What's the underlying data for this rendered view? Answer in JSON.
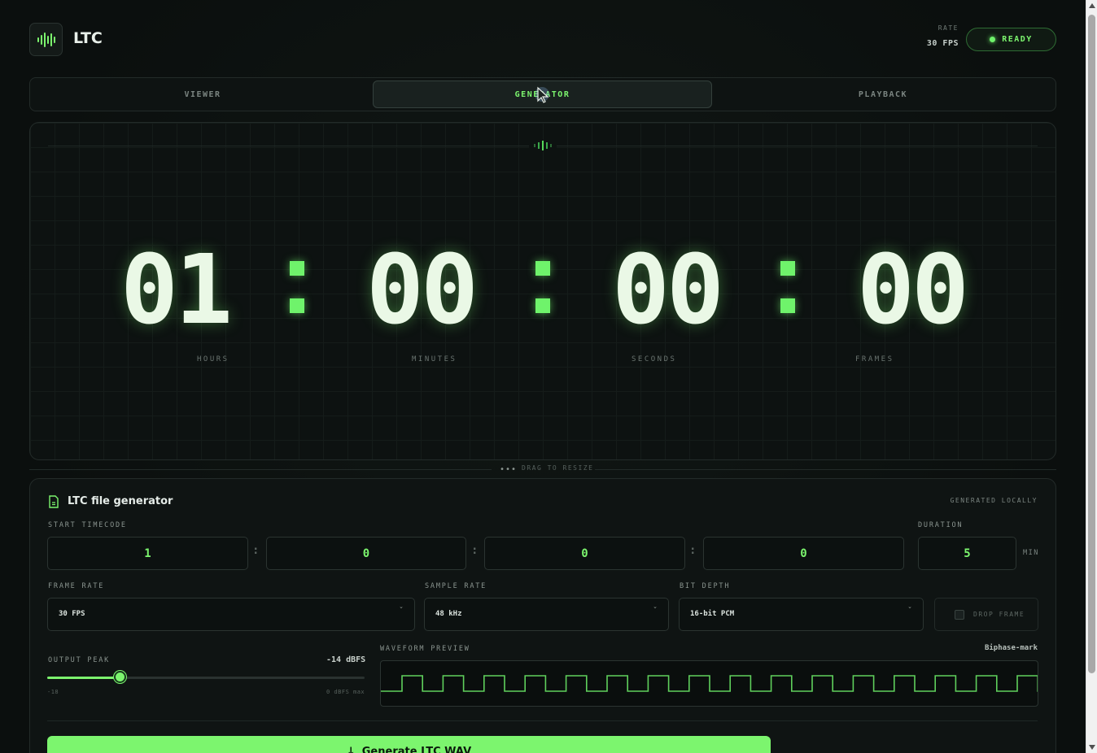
{
  "app": {
    "brand": "LTC"
  },
  "status": {
    "rate_label": "RATE",
    "rate_value": "30 FPS",
    "state": "READY"
  },
  "tabs": [
    {
      "label": "VIEWER",
      "active": false
    },
    {
      "label": "GENERATOR",
      "active": true
    },
    {
      "label": "PLAYBACK",
      "active": false
    }
  ],
  "timecode": {
    "hours": "01",
    "minutes": "00",
    "seconds": "00",
    "frames": "00",
    "labels": {
      "hours": "HOURS",
      "minutes": "MINUTES",
      "seconds": "SECONDS",
      "frames": "FRAMES"
    }
  },
  "resize": {
    "label": "DRAG TO RESIZE",
    "dots": "•••"
  },
  "generator": {
    "title": "LTC file generator",
    "note": "GENERATED LOCALLY",
    "start_label": "START TIMECODE",
    "start": {
      "h": "1",
      "m": "0",
      "s": "0",
      "f": "0"
    },
    "separator": ":",
    "duration_label": "DURATION",
    "duration_value": "5",
    "duration_unit": "MIN",
    "frame_rate_label": "FRAME RATE",
    "frame_rate_value": "30 FPS",
    "sample_rate_label": "SAMPLE RATE",
    "sample_rate_value": "48 kHz",
    "bit_depth_label": "BIT DEPTH",
    "bit_depth_value": "16-bit PCM",
    "drop_frame_label": "DROP FRAME",
    "drop_frame_checked": false,
    "output_peak_label": "OUTPUT PEAK",
    "output_peak_value": "-14 dBFS",
    "output_peak_fraction": 0.23,
    "slider_min_label": "-18",
    "slider_max_label": "0 dBFS max",
    "waveform_label": "WAVEFORM PREVIEW",
    "waveform_encoding": "Biphase-mark",
    "button_label": "Generate LTC WAV",
    "button_icon": "download-icon"
  },
  "colors": {
    "accent": "#7cf56e",
    "background": "#0b0f0e",
    "panel": "#0f1413"
  }
}
